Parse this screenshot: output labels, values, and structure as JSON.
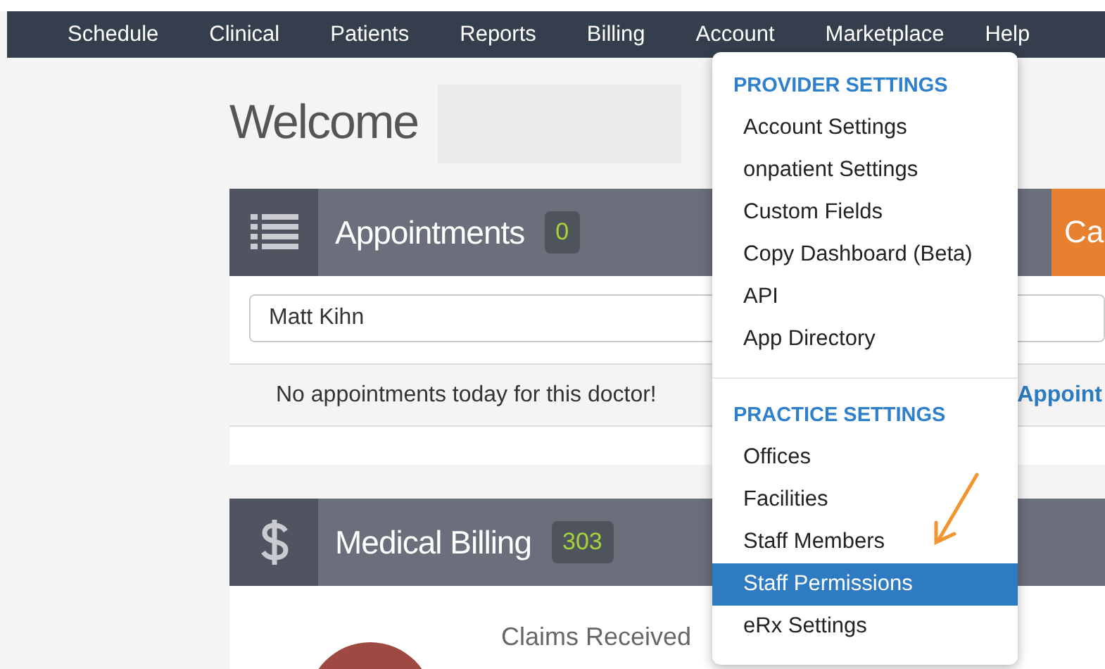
{
  "nav": {
    "items": [
      "Schedule",
      "Clinical",
      "Patients",
      "Reports",
      "Billing",
      "Account",
      "Marketplace",
      "Help"
    ]
  },
  "welcome": {
    "title": "Welcome"
  },
  "appointments": {
    "title": "Appointments",
    "count": "0",
    "action": "Ca",
    "doctor": "Matt Kihn",
    "message": "No appointments today for this doctor!",
    "link": "Appoint"
  },
  "billing": {
    "title": "Medical Billing",
    "count": "303",
    "claims_label": "Claims Received"
  },
  "account_menu": {
    "sections": [
      {
        "header": "PROVIDER SETTINGS",
        "items": [
          {
            "label": "Account Settings",
            "selected": false
          },
          {
            "label": "onpatient Settings",
            "selected": false
          },
          {
            "label": "Custom Fields",
            "selected": false
          },
          {
            "label": "Copy Dashboard (Beta)",
            "selected": false
          },
          {
            "label": "API",
            "selected": false
          },
          {
            "label": "App Directory",
            "selected": false
          }
        ]
      },
      {
        "header": "PRACTICE SETTINGS",
        "items": [
          {
            "label": "Offices",
            "selected": false
          },
          {
            "label": "Facilities",
            "selected": false
          },
          {
            "label": "Staff Members",
            "selected": false
          },
          {
            "label": "Staff Permissions",
            "selected": true
          },
          {
            "label": "eRx Settings",
            "selected": false
          }
        ]
      }
    ]
  }
}
